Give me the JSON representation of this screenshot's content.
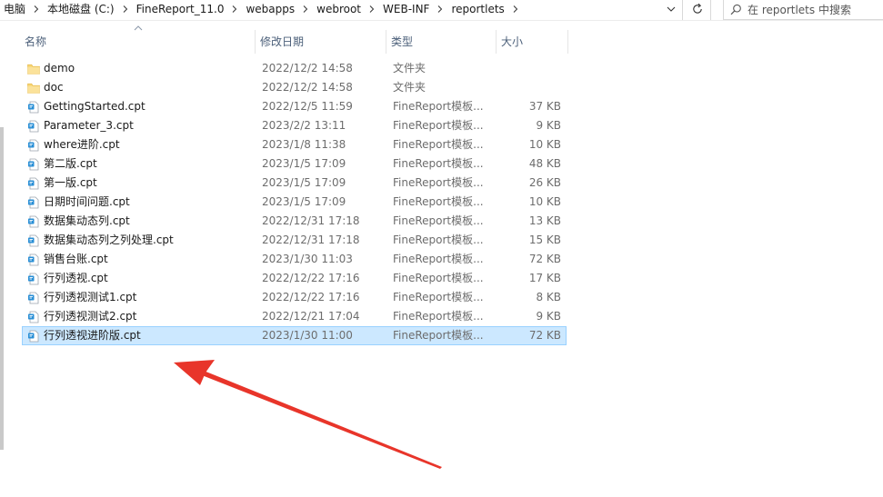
{
  "address_bar": {
    "breadcrumbs": [
      "电脑",
      "本地磁盘 (C:)",
      "FineReport_11.0",
      "webapps",
      "webroot",
      "WEB-INF",
      "reportlets"
    ],
    "search_placeholder": "在 reportlets 中搜索"
  },
  "columns": {
    "name": "名称",
    "date": "修改日期",
    "type": "类型",
    "size": "大小"
  },
  "files": [
    {
      "icon": "folder-icon",
      "name": "demo",
      "date": "2022/12/2 14:58",
      "type": "文件夹",
      "size": ""
    },
    {
      "icon": "folder-icon",
      "name": "doc",
      "date": "2022/12/2 14:58",
      "type": "文件夹",
      "size": ""
    },
    {
      "icon": "cpt-file-icon",
      "name": "GettingStarted.cpt",
      "date": "2022/12/5 11:59",
      "type": "FineReport模板...",
      "size": "37 KB"
    },
    {
      "icon": "cpt-file-icon",
      "name": "Parameter_3.cpt",
      "date": "2023/2/2 13:11",
      "type": "FineReport模板...",
      "size": "9 KB"
    },
    {
      "icon": "cpt-file-icon",
      "name": "where进阶.cpt",
      "date": "2023/1/8 11:38",
      "type": "FineReport模板...",
      "size": "10 KB"
    },
    {
      "icon": "cpt-file-icon",
      "name": "第二版.cpt",
      "date": "2023/1/5 17:09",
      "type": "FineReport模板...",
      "size": "48 KB"
    },
    {
      "icon": "cpt-file-icon",
      "name": "第一版.cpt",
      "date": "2023/1/5 17:09",
      "type": "FineReport模板...",
      "size": "26 KB"
    },
    {
      "icon": "cpt-file-icon",
      "name": "日期时间问题.cpt",
      "date": "2023/1/5 17:09",
      "type": "FineReport模板...",
      "size": "10 KB"
    },
    {
      "icon": "cpt-file-icon",
      "name": "数据集动态列.cpt",
      "date": "2022/12/31 17:18",
      "type": "FineReport模板...",
      "size": "13 KB"
    },
    {
      "icon": "cpt-file-icon",
      "name": "数据集动态列之列处理.cpt",
      "date": "2022/12/31 17:18",
      "type": "FineReport模板...",
      "size": "15 KB"
    },
    {
      "icon": "cpt-file-icon",
      "name": "销售台账.cpt",
      "date": "2023/1/30 11:03",
      "type": "FineReport模板...",
      "size": "72 KB"
    },
    {
      "icon": "cpt-file-icon",
      "name": "行列透视.cpt",
      "date": "2022/12/22 17:16",
      "type": "FineReport模板...",
      "size": "17 KB"
    },
    {
      "icon": "cpt-file-icon",
      "name": "行列透视测试1.cpt",
      "date": "2022/12/22 17:16",
      "type": "FineReport模板...",
      "size": "8 KB"
    },
    {
      "icon": "cpt-file-icon",
      "name": "行列透视测试2.cpt",
      "date": "2022/12/21 17:04",
      "type": "FineReport模板...",
      "size": "9 KB"
    },
    {
      "icon": "cpt-file-icon",
      "name": "行列透视进阶版.cpt",
      "date": "2023/1/30 11:00",
      "type": "FineReport模板...",
      "size": "72 KB",
      "selected": true
    }
  ],
  "colors": {
    "selection_bg": "#cce8ff",
    "selection_border": "#99d1ff",
    "folder": "#f8d775",
    "annotation_arrow": "#e8352a"
  }
}
